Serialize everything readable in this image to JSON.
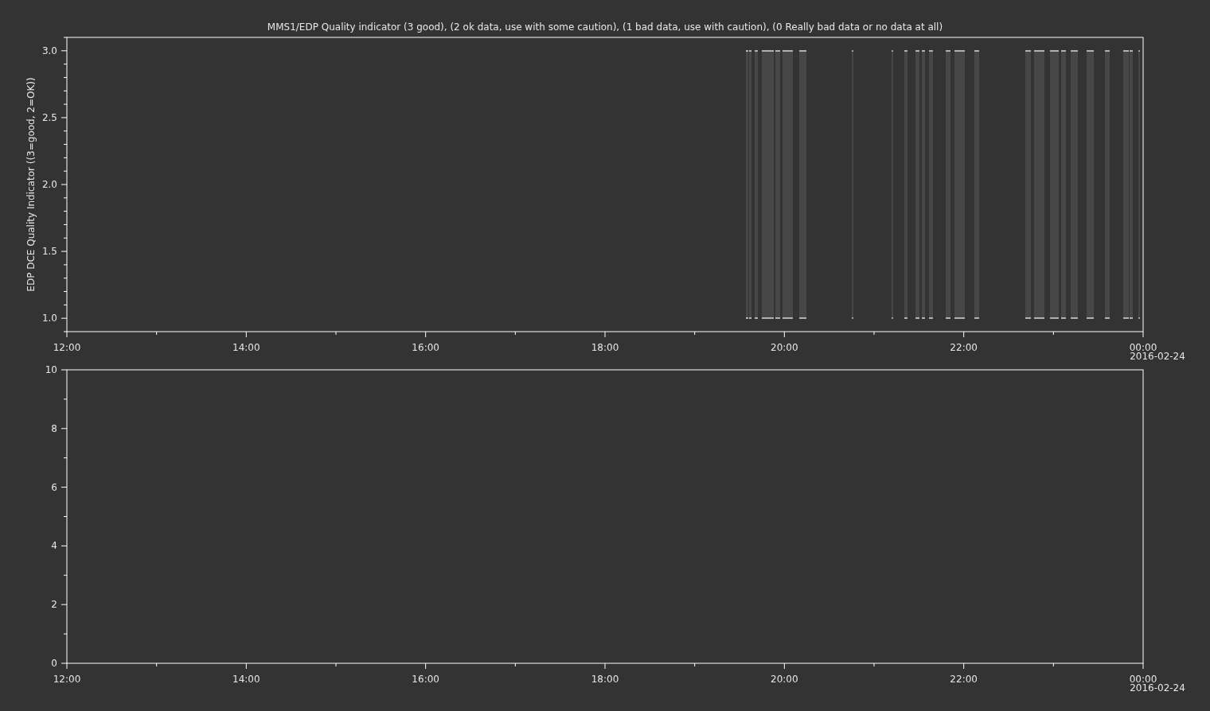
{
  "charts": [
    {
      "chart_data": {
        "type": "line",
        "title": "MMS1/EDP  Quality indicator (3 good), (2 ok data, use with some caution), (1 bad data, use with caution), (0 Really bad data or no data at all)",
        "ylabel": "EDP DCE Quality Indicator ((3=good, 2=OK))",
        "xlim": [
          12,
          24
        ],
        "ylim": [
          0.9,
          3.1
        ],
        "xticks": [
          {
            "value": 12,
            "label": "12:00"
          },
          {
            "value": 14,
            "label": "14:00"
          },
          {
            "value": 16,
            "label": "16:00"
          },
          {
            "value": 18,
            "label": "18:00"
          },
          {
            "value": 20,
            "label": "20:00"
          },
          {
            "value": 22,
            "label": "22:00"
          },
          {
            "value": 24,
            "label": "00:00"
          }
        ],
        "yticks": [
          {
            "value": 1,
            "label": "1.0"
          },
          {
            "value": 1.5,
            "label": "1.5"
          },
          {
            "value": 2,
            "label": "2.0"
          },
          {
            "value": 2.5,
            "label": "2.5"
          },
          {
            "value": 3,
            "label": "3.0"
          }
        ]
      },
      "date_label": "2016-02-24",
      "quality_bands": true
    },
    {
      "chart_data": {
        "type": "line",
        "xlim": [
          12,
          24
        ],
        "ylim": [
          0,
          10
        ],
        "xticks": [
          {
            "value": 12,
            "label": "12:00"
          },
          {
            "value": 14,
            "label": "14:00"
          },
          {
            "value": 16,
            "label": "16:00"
          },
          {
            "value": 18,
            "label": "18:00"
          },
          {
            "value": 20,
            "label": "20:00"
          },
          {
            "value": 22,
            "label": "22:00"
          },
          {
            "value": 24,
            "label": "00:00"
          }
        ],
        "yticks": [
          {
            "value": 0,
            "label": "0"
          },
          {
            "value": 2,
            "label": "2"
          },
          {
            "value": 4,
            "label": "4"
          },
          {
            "value": 6,
            "label": "6"
          },
          {
            "value": 8,
            "label": "8"
          },
          {
            "value": 10,
            "label": "10"
          }
        ]
      },
      "date_label": "2016-02-24"
    }
  ]
}
